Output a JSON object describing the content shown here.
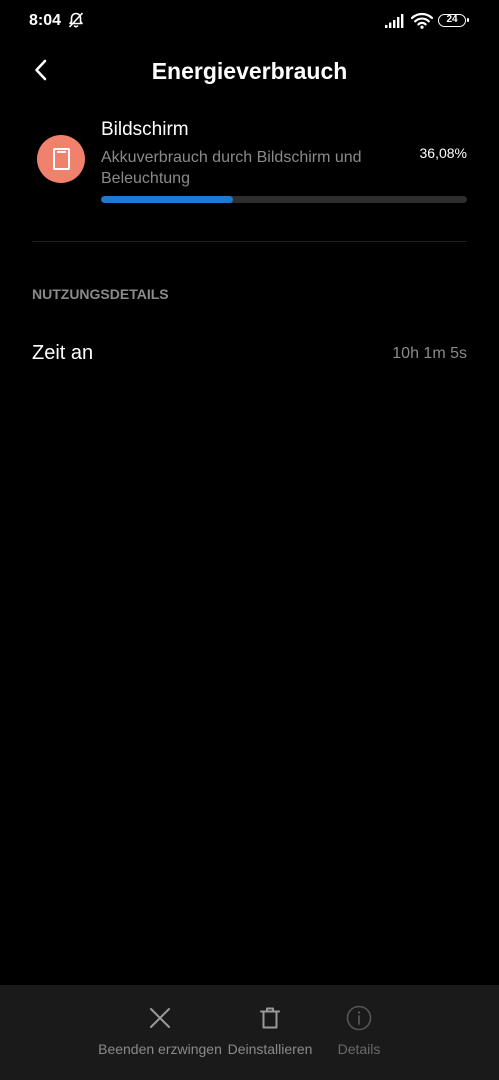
{
  "status_bar": {
    "time": "8:04",
    "battery": "24",
    "icons": [
      "notifications-off-icon",
      "signal-icon",
      "wifi-icon",
      "battery-icon"
    ]
  },
  "header": {
    "title": "Energieverbrauch",
    "back_icon": "chevron-left-icon"
  },
  "usage_item": {
    "name": "Bildschirm",
    "description": "Akkuverbrauch durch Bildschirm und Beleuchtung",
    "percent": "36,08%",
    "fraction": 0.3608,
    "icon": "screen-icon",
    "icon_color": "#f0826d",
    "bar_color": "#1e78d4"
  },
  "section": {
    "header": "NUTZUNGSDETAILS"
  },
  "details": [
    {
      "label": "Zeit an",
      "value": "10h 1m 5s"
    }
  ],
  "bottom_actions": [
    {
      "label": "Beenden erzwingen",
      "icon": "close-icon"
    },
    {
      "label": "Deinstallieren",
      "icon": "trash-icon"
    },
    {
      "label": "Details",
      "icon": "info-icon"
    }
  ]
}
